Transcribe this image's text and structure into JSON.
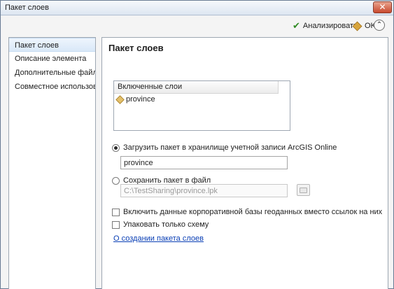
{
  "window": {
    "title": "Пакет слоев",
    "close_glyph": "✕"
  },
  "toolbar": {
    "analyze_label": "Анализировать",
    "analyze_icon": "check-icon",
    "ok_label": "OK",
    "ok_icon": "package-icon",
    "collapse_icon": "chevron-up-icon",
    "collapse_glyph": "⌃"
  },
  "sidebar": {
    "items": [
      {
        "label": "Пакет слоев"
      },
      {
        "label": "Описание элемента"
      },
      {
        "label": "Дополнительные файлы"
      },
      {
        "label": "Совместное использование"
      }
    ],
    "selected": "Пакет слоев"
  },
  "panel": {
    "title": "Пакет слоев",
    "layers_header": "Включенные слои",
    "layers": [
      {
        "name": "province",
        "icon": "layer-icon"
      }
    ],
    "option_upload": {
      "label": "Загрузить пакет в хранилище учетной записи ArcGIS Online",
      "checked": true,
      "value": "province"
    },
    "option_save": {
      "label": "Сохранить пакет в файл",
      "checked": false,
      "value": "C:\\TestSharing\\province.lpk"
    },
    "checkbox_enterprise": {
      "label": "Включить данные корпоративной базы геоданных вместо ссылок на них",
      "checked": false
    },
    "checkbox_schema": {
      "label": "Упаковать только схему",
      "checked": false
    },
    "help_link": "О создании пакета слоев"
  },
  "colors": {
    "link": "#0a3fb5",
    "analyze_check": "#2f8a22",
    "close_button": "#c8492d"
  }
}
